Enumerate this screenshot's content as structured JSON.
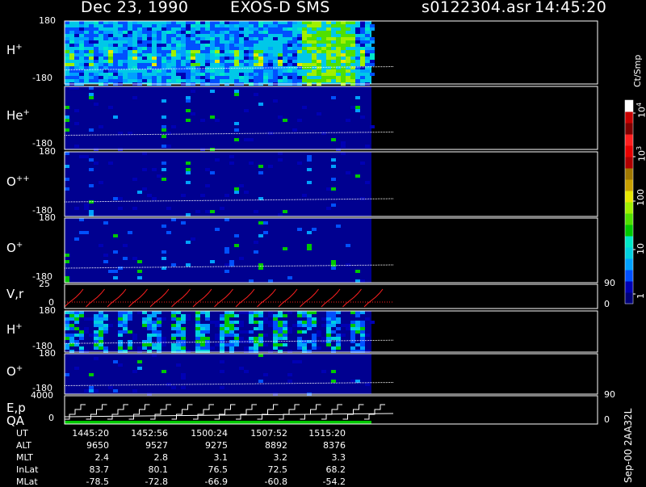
{
  "header": {
    "date": "Dec 23, 1990",
    "instrument": "EXOS-D SMS",
    "file": "s0122304.asr",
    "time": "14:45:20"
  },
  "colorbar": {
    "unit_label": "Ct/Smp",
    "tick_labels": [
      "1",
      "10",
      "100",
      "10",
      "10"
    ],
    "tick_exps": [
      "",
      "",
      "",
      "3",
      "4"
    ],
    "colors": [
      "#00007a",
      "#0000b4",
      "#0050ff",
      "#00a0ff",
      "#00d0e0",
      "#00e8c8",
      "#00c800",
      "#50e000",
      "#a0f000",
      "#e8e800",
      "#c8a000",
      "#a07800",
      "#b00000",
      "#e80000",
      "#ff2020",
      "#800000",
      "#c80000",
      "#ffffff"
    ]
  },
  "footer": {
    "row_labels": [
      "UT",
      "ALT",
      "MLT",
      "InLat",
      "MLat"
    ],
    "columns": [
      [
        "1445:20",
        "9650",
        "2.4",
        "83.7",
        "-78.5"
      ],
      [
        "1452:56",
        "9527",
        "2.8",
        "80.1",
        "-72.8"
      ],
      [
        "1500:24",
        "9275",
        "3.1",
        "76.5",
        "-66.9"
      ],
      [
        "1507:52",
        "8892",
        "3.2",
        "72.5",
        "-60.8"
      ],
      [
        "1515:20",
        "8376",
        "3.3",
        "68.2",
        "-54.2"
      ]
    ],
    "side_label": "Sep-00 2AA32L"
  },
  "chart_data": [
    {
      "type": "heatmap",
      "panel": "H+",
      "label_base": "H",
      "label_sup": "+",
      "ymin": "-180",
      "ymax": "180"
    },
    {
      "type": "heatmap",
      "panel": "He+",
      "label_base": "He",
      "label_sup": "+",
      "ymin": "-180",
      "ymax": ""
    },
    {
      "type": "heatmap",
      "panel": "O++",
      "label_base": "O",
      "label_sup": "++",
      "ymin": "-180",
      "ymax": "180"
    },
    {
      "type": "heatmap",
      "panel": "O+",
      "label_base": "O",
      "label_sup": "+",
      "ymin": "-180",
      "ymax": "180"
    },
    {
      "type": "line",
      "panel": "V,r",
      "label_base": "V,r",
      "label_sup": "",
      "ymin": "0",
      "ymax": "25",
      "right_top": "90",
      "right_bottom": "0"
    },
    {
      "type": "heatmap",
      "panel": "H+ (2)",
      "label_base": "H",
      "label_sup": "+",
      "ymin": "-180",
      "ymax": "180"
    },
    {
      "type": "heatmap",
      "panel": "O+ (2)",
      "label_base": "O",
      "label_sup": "+",
      "ymin": "-180",
      "ymax": "180"
    },
    {
      "type": "line",
      "panel": "E,p QA",
      "label_base": "E,p",
      "label2": "QA",
      "label_sup": "",
      "ymin": "0",
      "ymax": "4000",
      "right_top": "90",
      "right_bottom": "0"
    }
  ]
}
